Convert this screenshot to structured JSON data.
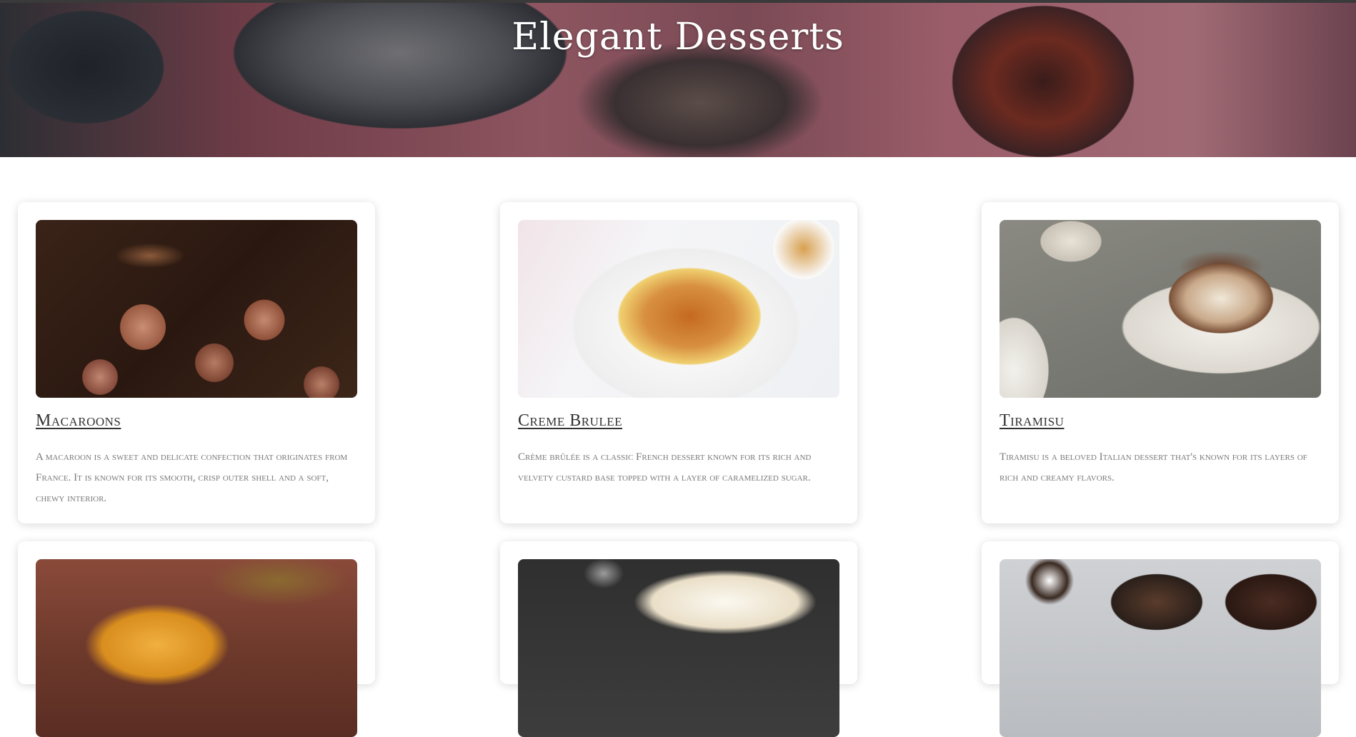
{
  "header": {
    "title": "Elegant Desserts"
  },
  "cards": [
    {
      "title": "Macaroons",
      "description": "A macaroon is a sweet and delicate confection that originates from France. It is known for its smooth, crisp outer shell and a soft, chewy interior."
    },
    {
      "title": "Creme Brulee",
      "description": "Crème brûlée is a classic French dessert known for its rich and velvety custard base topped with a layer of caramelized sugar."
    },
    {
      "title": "Tiramisu",
      "description": "Tiramisu is a beloved Italian dessert that's known for its layers of rich and creamy flavors."
    }
  ],
  "colors": {
    "title_text": "#333333",
    "description_text": "#7a7a7a",
    "hero_text": "#ffffff"
  }
}
